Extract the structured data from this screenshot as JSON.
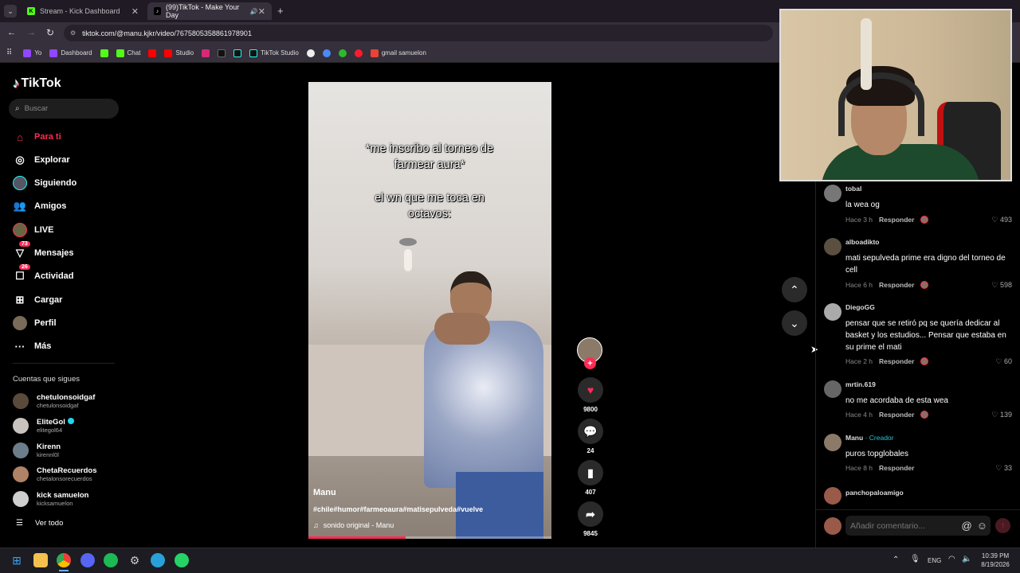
{
  "browser": {
    "tabs": [
      {
        "title": "Stream - Kick Dashboard"
      },
      {
        "title": "(99)TikTok - Make Your Day"
      }
    ],
    "url": "tiktok.com/@manu.kjkr/video/7675805358861978901",
    "bookmarks": [
      "Yo",
      "Dashboard",
      "Chat",
      "Studio",
      "TikTok Studio",
      "gmail samuelon"
    ]
  },
  "sidebar": {
    "logo": "TikTok",
    "search_placeholder": "Buscar",
    "nav": [
      {
        "label": "Para ti",
        "icon": "home-icon"
      },
      {
        "label": "Explorar",
        "icon": "compass-icon"
      },
      {
        "label": "Siguiendo",
        "icon": "following-icon"
      },
      {
        "label": "Amigos",
        "icon": "friends-icon"
      },
      {
        "label": "LIVE",
        "icon": "live-icon"
      },
      {
        "label": "Mensajes",
        "icon": "messages-icon",
        "badge": "73"
      },
      {
        "label": "Actividad",
        "icon": "activity-icon",
        "badge": "26"
      },
      {
        "label": "Cargar",
        "icon": "upload-icon"
      },
      {
        "label": "Perfil",
        "icon": "profile-icon"
      },
      {
        "label": "Más",
        "icon": "more-icon"
      }
    ],
    "following_title": "Cuentas que sigues",
    "accounts": [
      {
        "name": "chetulonsoidgaf",
        "handle": "chetulonsoidgaf"
      },
      {
        "name": "EliteGol",
        "handle": "elitegol64"
      },
      {
        "name": "Kirenn",
        "handle": "kirennl0l"
      },
      {
        "name": "ChetaRecuerdos",
        "handle": "chetalonsorecuerdos"
      },
      {
        "name": "kick samuelon",
        "handle": "kicksamuelon"
      }
    ],
    "see_all": "Ver todo"
  },
  "video": {
    "overlay_line1": "*me inscribo al torneo de farmear aura*",
    "overlay_line2": "el wn que me toca en octavos:",
    "author": "Manu",
    "hashtags": "#chile#humor#farmeoaura#matisepulveda#vuelve",
    "sound": "sonido original - Manu",
    "progress": 0.4
  },
  "actions": {
    "likes": "9800",
    "comments": "24",
    "saves": "407",
    "shares": "9845"
  },
  "comments": [
    {
      "user": "tobal",
      "text": "la wea og",
      "time": "Hace 3 h",
      "reply": "Responder",
      "likes": "493"
    },
    {
      "user": "alboadikto",
      "text": "mati sepulveda prime era digno del torneo de cell",
      "time": "Hace 6 h",
      "reply": "Responder",
      "likes": "598"
    },
    {
      "user": "DiegoGG",
      "text": "pensar que se retiró pq se quería dedicar al basket y los estudios... Pensar que estaba en su prime el mati",
      "time": "Hace 2 h",
      "reply": "Responder",
      "likes": "60"
    },
    {
      "user": "mrtin.619",
      "text": "no me acordaba de esta wea",
      "time": "Hace 4 h",
      "reply": "Responder",
      "likes": "139"
    },
    {
      "user": "Manu",
      "creator": "· Creador",
      "text": "puros topglobales",
      "time": "Hace 8 h",
      "reply": "Responder",
      "likes": "33"
    },
    {
      "user": "panchopaloamigo"
    }
  ],
  "comment_input_placeholder": "Añadir comentario...",
  "taskbar": {
    "lang": "ENG",
    "time": "10:39 PM",
    "date": "8/19/2026"
  }
}
